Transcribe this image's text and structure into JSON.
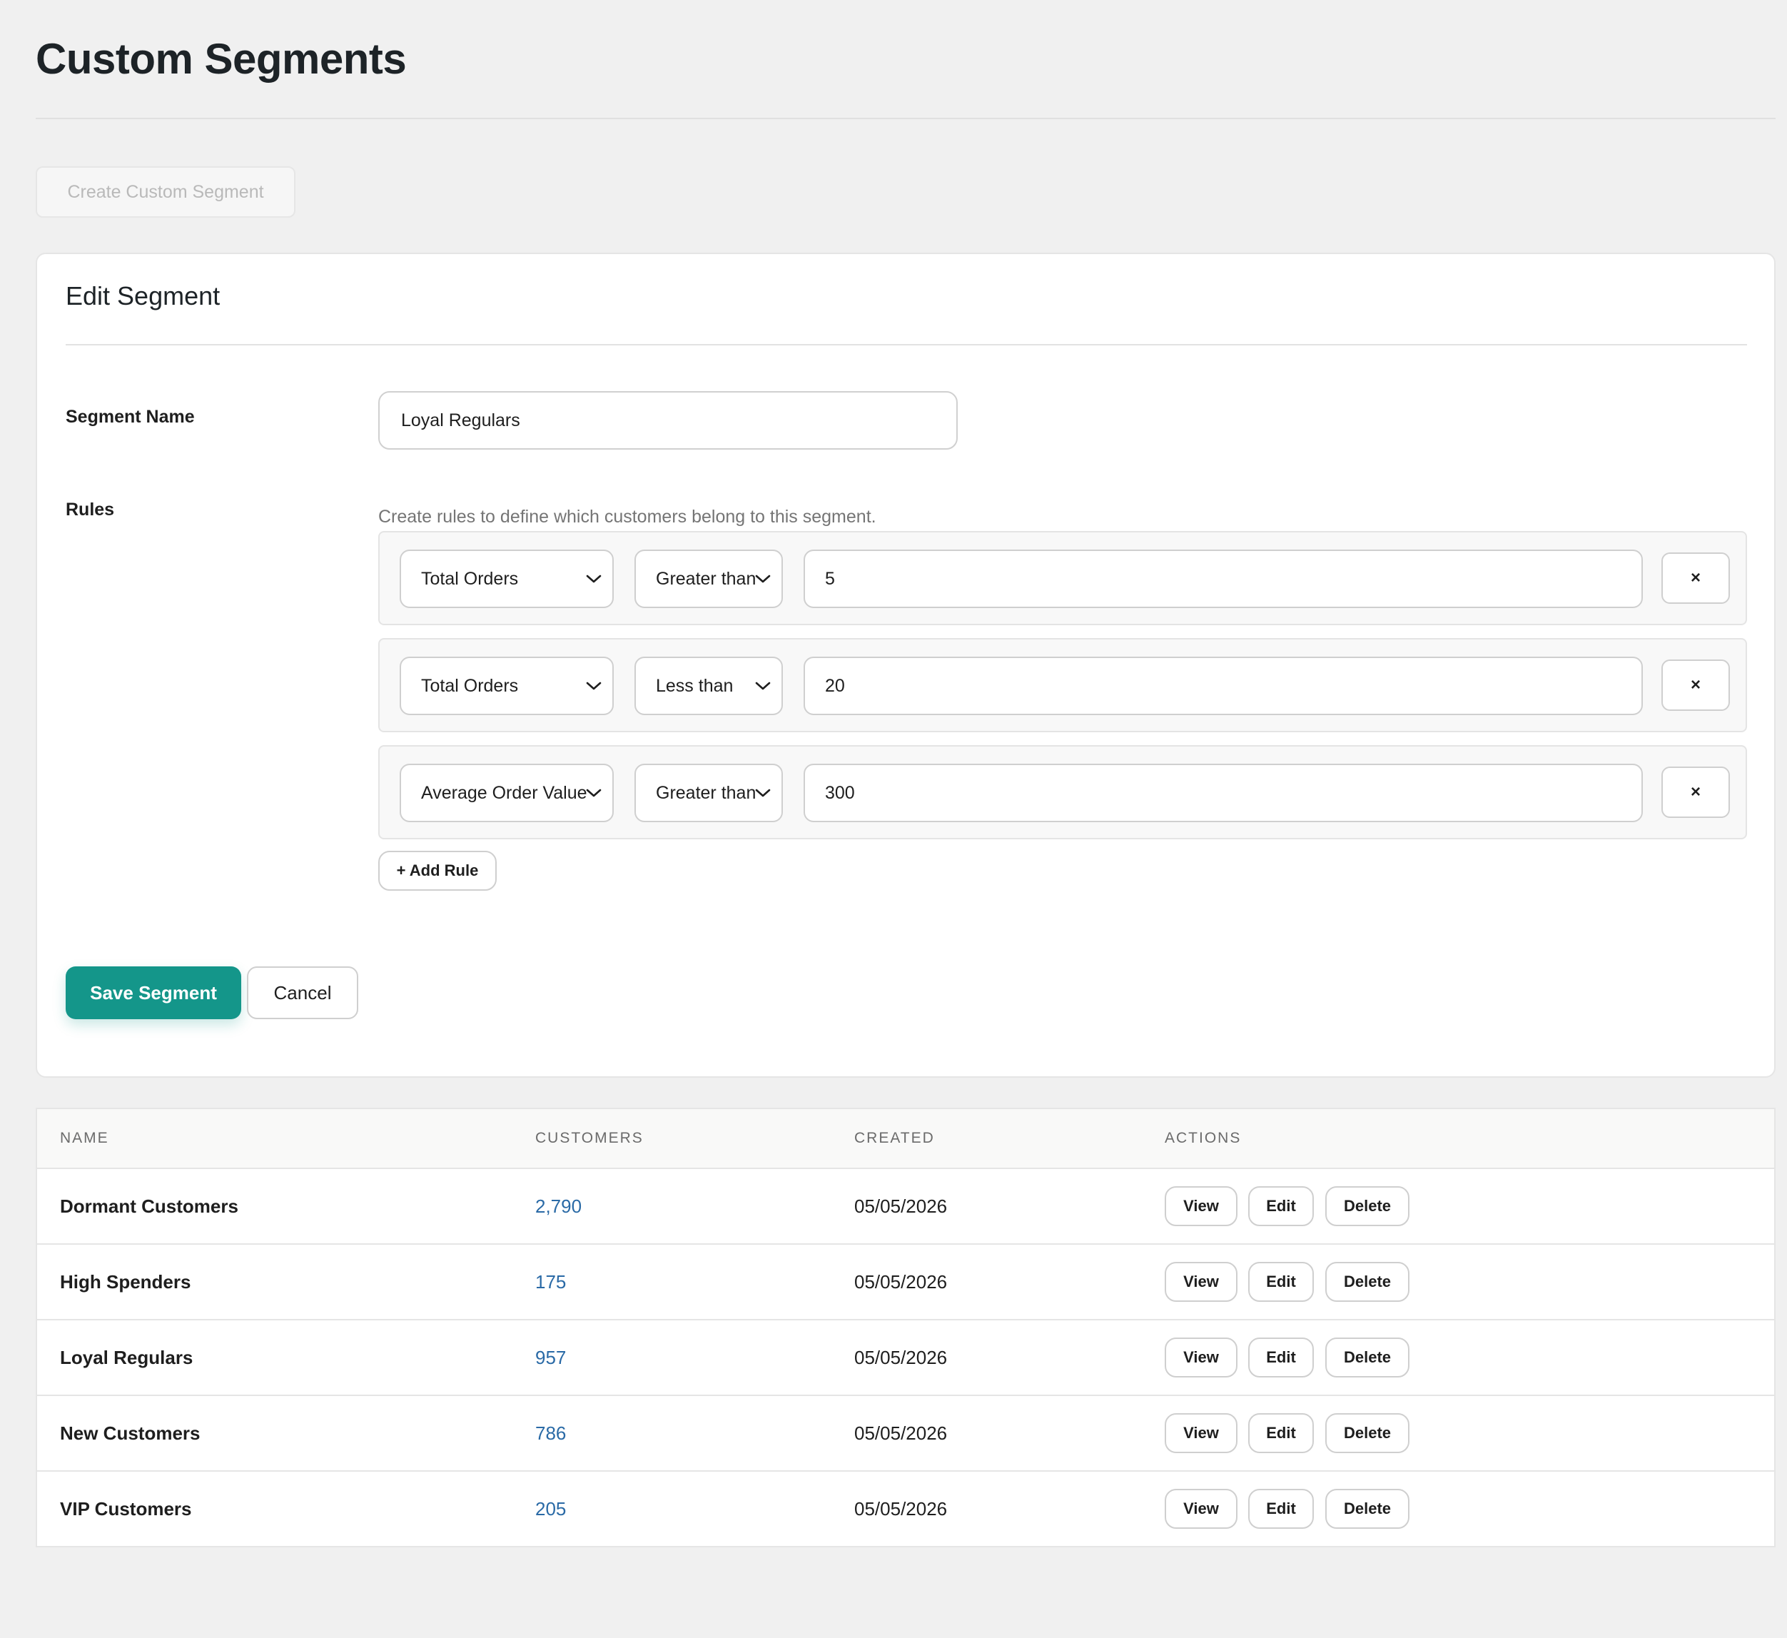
{
  "page": {
    "title": "Custom Segments",
    "create_button": "Create Custom Segment"
  },
  "editor": {
    "title": "Edit Segment",
    "segment_name_label": "Segment Name",
    "segment_name_value": "Loyal Regulars",
    "rules_label": "Rules",
    "rules_help": "Create rules to define which customers belong to this segment.",
    "rules": [
      {
        "field": "Total Orders",
        "operator": "Greater than",
        "value": "5",
        "remove": "×"
      },
      {
        "field": "Total Orders",
        "operator": "Less than",
        "value": "20",
        "remove": "×"
      },
      {
        "field": "Average Order Value",
        "operator": "Greater than",
        "value": "300",
        "remove": "×"
      }
    ],
    "add_rule": "+ Add Rule",
    "save": "Save Segment",
    "cancel": "Cancel"
  },
  "table": {
    "columns": {
      "name": "NAME",
      "customers": "CUSTOMERS",
      "created": "CREATED",
      "actions": "ACTIONS"
    },
    "rows": [
      {
        "name": "Dormant Customers",
        "customers": "2,790",
        "created": "05/05/2026"
      },
      {
        "name": "High Spenders",
        "customers": "175",
        "created": "05/05/2026"
      },
      {
        "name": "Loyal Regulars",
        "customers": "957",
        "created": "05/05/2026"
      },
      {
        "name": "New Customers",
        "customers": "786",
        "created": "05/05/2026"
      },
      {
        "name": "VIP Customers",
        "customers": "205",
        "created": "05/05/2026"
      }
    ],
    "actions": {
      "view": "View",
      "edit": "Edit",
      "delete": "Delete"
    }
  },
  "colors": {
    "primary": "#14968a",
    "link": "#2a6aa6",
    "background": "#f0f0f0"
  },
  "icons": {
    "select_arrow": "chevron-down-icon",
    "remove_rule": "close-icon"
  }
}
